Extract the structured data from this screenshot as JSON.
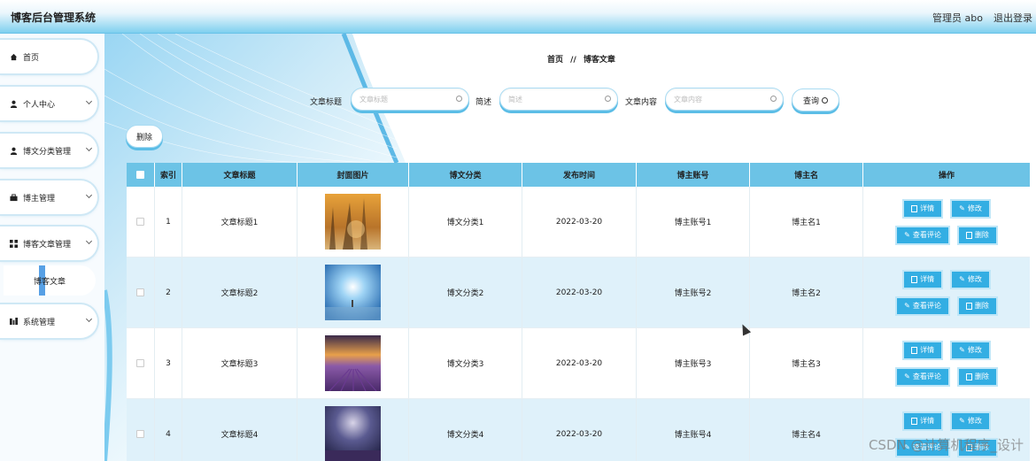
{
  "app": {
    "title": "博客后台管理系统",
    "user": "管理员 abo",
    "logout": "退出登录"
  },
  "sidebar": {
    "items": [
      {
        "label": "首页",
        "icon": "home-icon"
      },
      {
        "label": "个人中心",
        "icon": "user-icon"
      },
      {
        "label": "博文分类管理",
        "icon": "user-icon"
      },
      {
        "label": "博主管理",
        "icon": "briefcase-icon"
      },
      {
        "label": "博客文章管理",
        "icon": "grid-icon"
      },
      {
        "label": "系统管理",
        "icon": "chart-icon"
      }
    ],
    "sub_item": "博客文章"
  },
  "breadcrumb": {
    "home": "首页",
    "sep": "//",
    "current": "博客文章"
  },
  "search": {
    "title_label": "文章标题",
    "title_placeholder": "文章标题",
    "summary_label": "简述",
    "summary_placeholder": "简述",
    "content_label": "文章内容",
    "content_placeholder": "文章内容",
    "button": "查询"
  },
  "toolbar": {
    "delete": "删除"
  },
  "table": {
    "headers": [
      "",
      "索引",
      "文章标题",
      "封面图片",
      "博文分类",
      "发布时间",
      "博主账号",
      "博主名",
      "操作"
    ],
    "rows": [
      {
        "index": "1",
        "title": "文章标题1",
        "category": "博文分类1",
        "date": "2022-03-20",
        "account": "博主账号1",
        "name": "博主名1"
      },
      {
        "index": "2",
        "title": "文章标题2",
        "category": "博文分类2",
        "date": "2022-03-20",
        "account": "博主账号2",
        "name": "博主名2"
      },
      {
        "index": "3",
        "title": "文章标题3",
        "category": "博文分类3",
        "date": "2022-03-20",
        "account": "博主账号3",
        "name": "博主名3"
      },
      {
        "index": "4",
        "title": "文章标题4",
        "category": "博文分类4",
        "date": "2022-03-20",
        "account": "博主账号4",
        "name": "博主名4"
      }
    ],
    "ops": {
      "detail": "详情",
      "edit": "修改",
      "comments": "查看评论",
      "delete": "删除"
    }
  },
  "watermark": "CSDN @计算机程序_设计",
  "colors": {
    "accent": "#33aee3",
    "header": "#6cc3e6",
    "row_alt": "#dff1fa"
  }
}
